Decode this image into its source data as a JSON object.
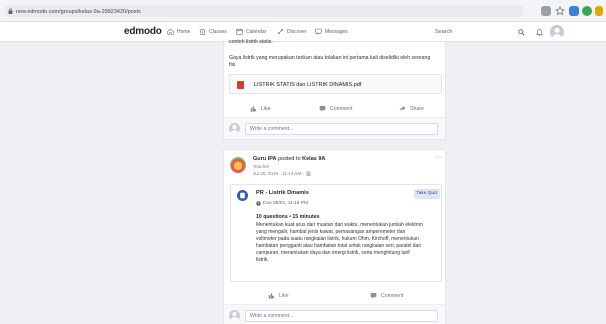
{
  "browser": {
    "url": "new.edmodo.com/groups/kelas-9a-29823420/posts"
  },
  "header": {
    "logo": "edmodo",
    "nav": [
      {
        "label": "Home",
        "icon": "home-icon"
      },
      {
        "label": "Classes",
        "icon": "classes-icon"
      },
      {
        "label": "Calendar",
        "icon": "calendar-icon"
      },
      {
        "label": "Discover",
        "icon": "discover-icon"
      },
      {
        "label": "Messages",
        "icon": "messages-icon"
      }
    ],
    "search_placeholder": "Search"
  },
  "post1": {
    "text_top": "contoh listrik statis.",
    "text_line1": "Gaya listrik yang merupakan tarikan atau tolakan ini pertama kali diselidiki oleh seorang",
    "text_line2": "fisi",
    "attachment": "LISTRIK STATIS dan LISTRIK DINAMIS.pdf",
    "like": "Like",
    "comment": "Comment",
    "share": "Share",
    "comment_placeholder": "Write a comment..."
  },
  "post2": {
    "poster": "Guru IPA",
    "posted_to_text": "posted to",
    "group": "Kelas 9A",
    "role": "Teacher",
    "timestamp": "Jul 25, 2019 · 11:14 AM ·",
    "more": "···",
    "assignment": {
      "title": "PR - Listrik Dinamis",
      "button": "Take Quiz",
      "due": "Due 08/01, 11:15 PM",
      "summary": "10 questions • 15 minutes",
      "description": [
        "Menentukan kuat arus dari muatan dan waktu, menentukan jumlah elektron",
        "yang mengalir, hambat jenis kawat, pemasangan amperemeter dan",
        "voltmeter pada suatu rangkaian listrik, hukum Ohm, Kirchoff, menentukan",
        "hambatan pengganti atau hambatan total untuk rangkaian seri, paralel dan",
        "campuran, menentukan daya dan energi listrik, serta menghitung tarif",
        "listrik."
      ]
    },
    "like": "Like",
    "comment": "Comment",
    "comment_placeholder": "Write a comment..."
  },
  "colors": {
    "accent_blue": "#2d5bb7",
    "pdf_red": "#d63b30",
    "page_bg": "#eef0f3"
  }
}
